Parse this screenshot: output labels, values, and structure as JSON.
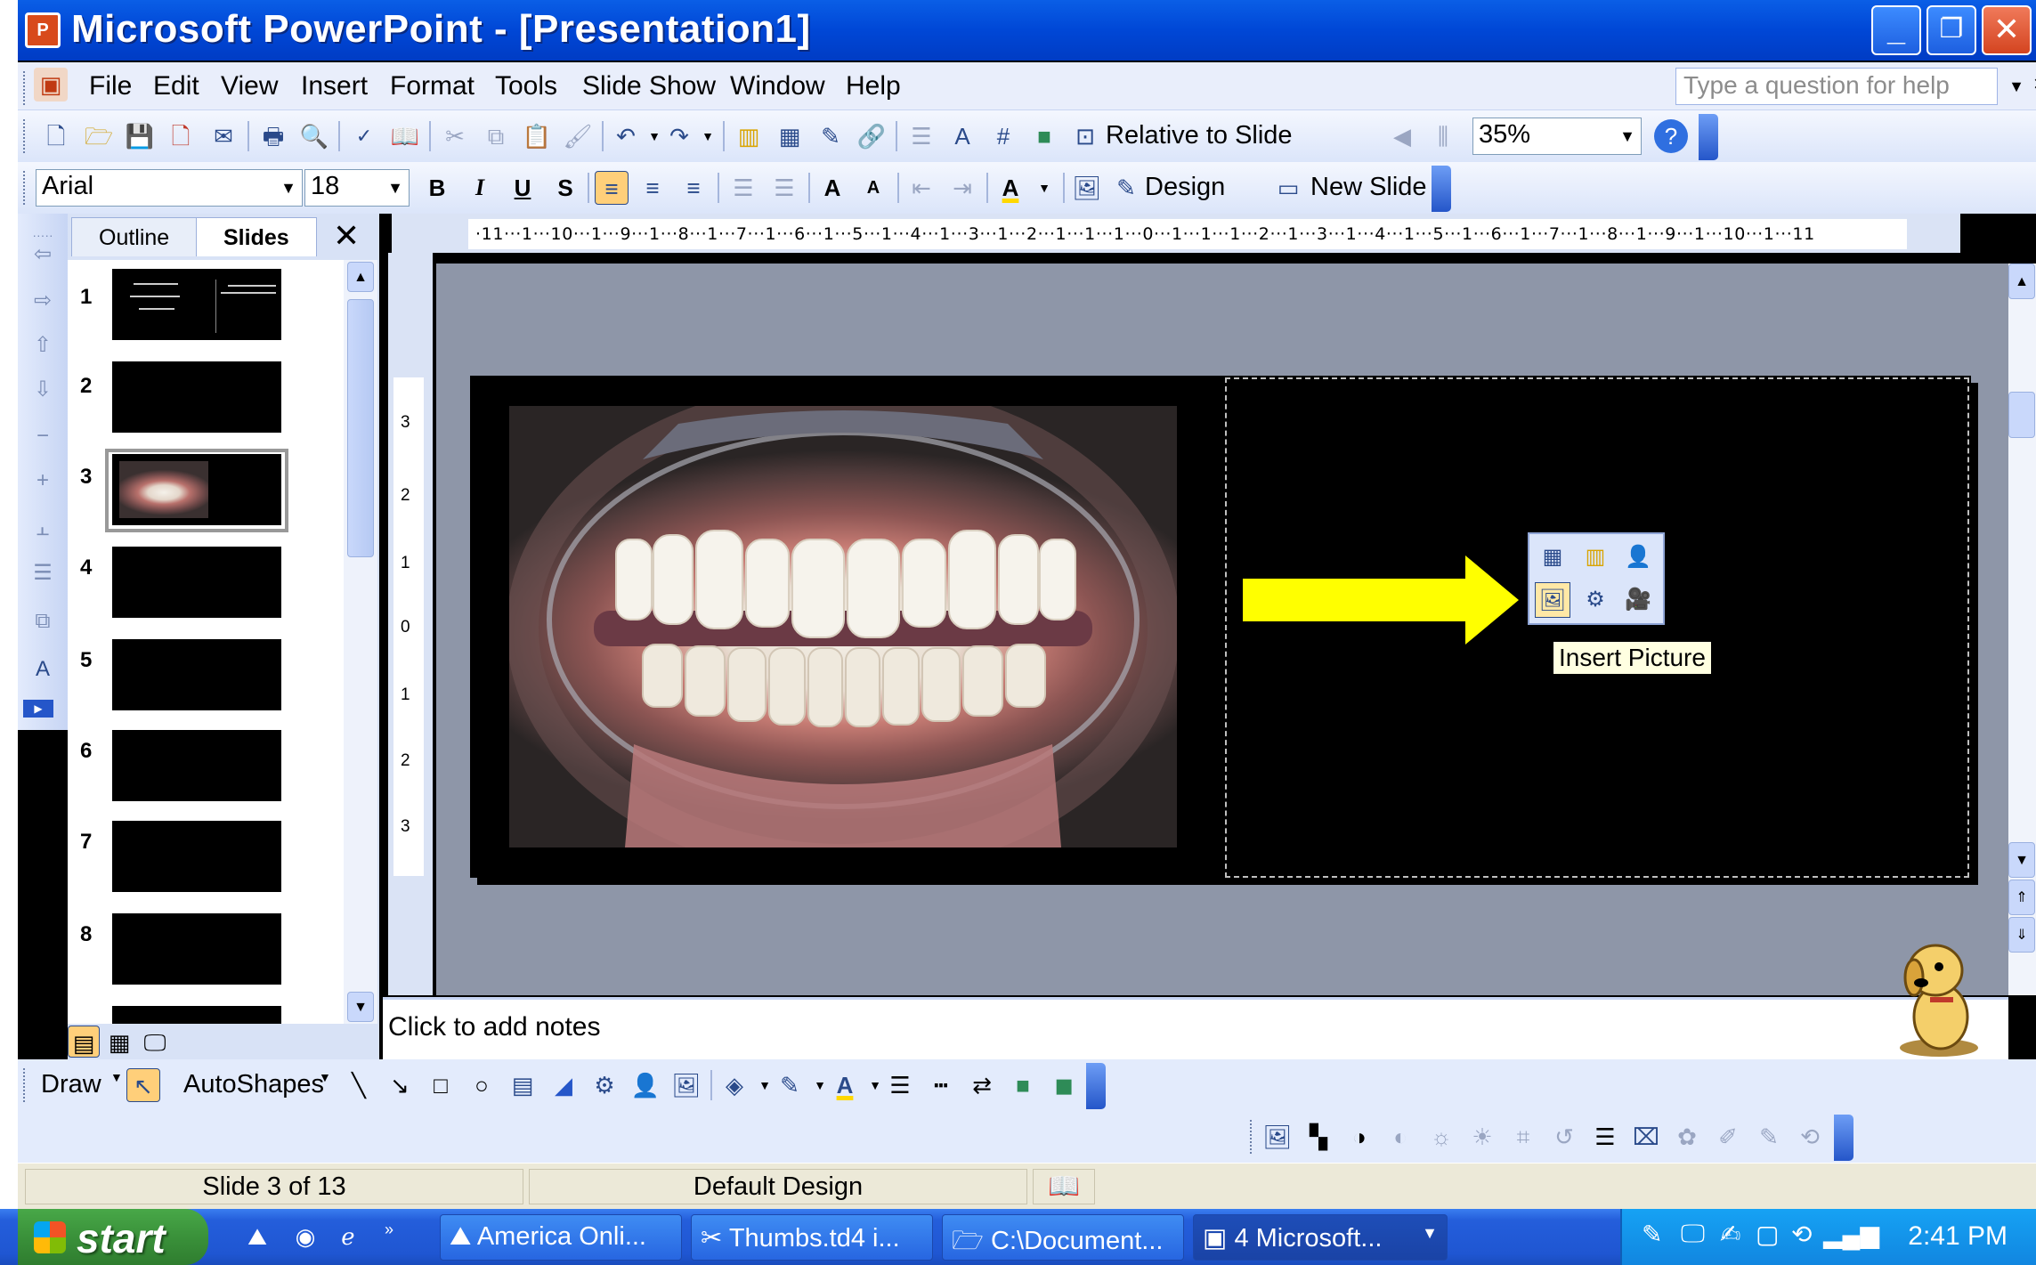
{
  "window": {
    "title": "Microsoft PowerPoint - [Presentation1]",
    "icon": "powerpoint-icon",
    "controls": [
      "minimize",
      "restore",
      "close"
    ]
  },
  "menubar": {
    "items": [
      "File",
      "Edit",
      "View",
      "Insert",
      "Format",
      "Tools",
      "Slide Show",
      "Window",
      "Help"
    ],
    "help_placeholder": "Type a question for help"
  },
  "standard_toolbar": {
    "relative_to_slide": "Relative to Slide",
    "zoom": "35%"
  },
  "formatting_toolbar": {
    "font": "Arial",
    "size": "18",
    "bold": "B",
    "italic": "I",
    "underline": "U",
    "shadow": "S",
    "design": "Design",
    "new_slide": "New Slide"
  },
  "slides_pane": {
    "tabs": [
      "Outline",
      "Slides"
    ],
    "active_tab": "Slides",
    "close": "✕",
    "slide_numbers": [
      "1",
      "2",
      "3",
      "4",
      "5",
      "6",
      "7",
      "8"
    ],
    "selected": 3
  },
  "rulers": {
    "horizontal": "·11···1···10···1···9···1···8···1···7···1···6···1···5···1···4···1···3···1···2···1···1···1···0···1···1···1···2···1···3···1···4···1···5···1···6···1···7···1···8···1···9···1···10···1···11",
    "vertical": [
      "3",
      "2",
      "1",
      "0",
      "1",
      "2",
      "3"
    ]
  },
  "content_palette": {
    "icons": [
      "insert-table-icon",
      "insert-chart-icon",
      "insert-clip-art-icon",
      "insert-picture-icon",
      "insert-diagram-icon",
      "insert-media-clip-icon"
    ],
    "tooltip": "Insert Picture"
  },
  "notes": {
    "placeholder": "Click to add notes"
  },
  "drawing_toolbar": {
    "draw": "Draw",
    "autoshapes": "AutoShapes"
  },
  "status": {
    "slide": "Slide 3 of 13",
    "design": "Default Design"
  },
  "taskbar": {
    "start": "start",
    "tasks": [
      "America  Onli...",
      "Thumbs.td4 i...",
      "C:\\Document...",
      "4 Microsoft..."
    ],
    "clock": "2:41 PM"
  },
  "colors": {
    "titlebar": "#0047d6",
    "arrow": "#ffff00",
    "workarea": "#8e96a8",
    "tooltip": "#ffffe1"
  }
}
